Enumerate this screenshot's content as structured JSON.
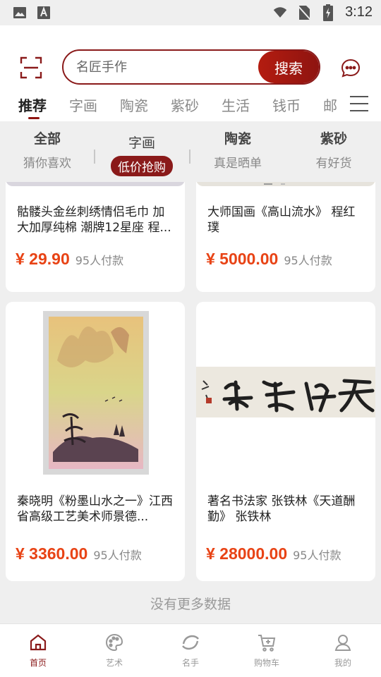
{
  "status_bar": {
    "time": "3:12"
  },
  "search": {
    "placeholder": "名匠手作",
    "button_label": "搜索"
  },
  "tabs": [
    {
      "label": "推荐"
    },
    {
      "label": "字画"
    },
    {
      "label": "陶瓷"
    },
    {
      "label": "紫砂"
    },
    {
      "label": "生活"
    },
    {
      "label": "钱币"
    },
    {
      "label": "邮"
    }
  ],
  "subcategories": [
    {
      "title": "全部",
      "subtitle": "猜你喜欢"
    },
    {
      "title": "字画",
      "subtitle": "低价抢购"
    },
    {
      "title": "陶瓷",
      "subtitle": "真是晒单"
    },
    {
      "title": "紫砂",
      "subtitle": "有好货"
    }
  ],
  "products": [
    {
      "title": "骷髅头金丝刺绣情侣毛巾 加大加厚纯棉 潮牌12星座 程...",
      "price": "¥ 29.90",
      "sales": "95人付款"
    },
    {
      "title": "大师国画《高山流水》 程红璞",
      "price": "¥ 5000.00",
      "sales": "95人付款"
    },
    {
      "title": "秦晓明《粉墨山水之一》江西省高级工艺美术师景德...",
      "price": "¥ 3360.00",
      "sales": "95人付款"
    },
    {
      "title": "著名书法家 张铁林《天道酬勤》 张铁林",
      "price": "¥ 28000.00",
      "sales": "95人付款"
    }
  ],
  "no_more_text": "没有更多数据",
  "bottom_nav": [
    {
      "label": "首页"
    },
    {
      "label": "艺术"
    },
    {
      "label": "名手"
    },
    {
      "label": "购物车"
    },
    {
      "label": "我的"
    }
  ],
  "colors": {
    "brand": "#8a1a1a",
    "price": "#e84315"
  }
}
